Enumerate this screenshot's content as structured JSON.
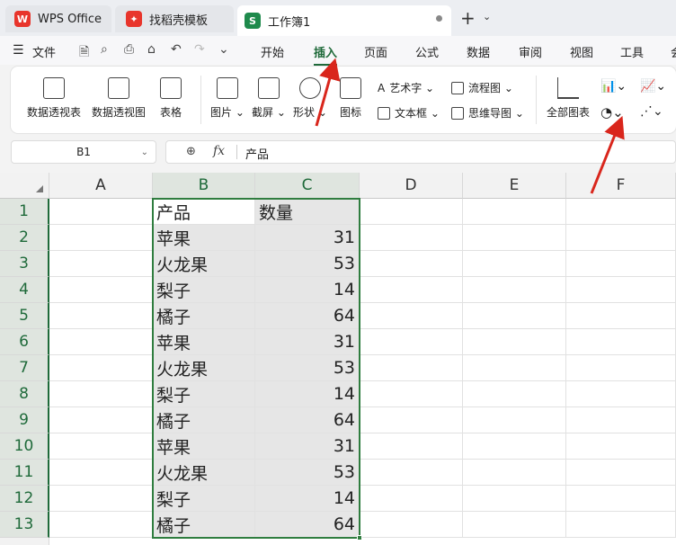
{
  "tabs": [
    {
      "label": "WPS Office",
      "icon": "wps-logo-icon",
      "color": "#e8352c"
    },
    {
      "label": "找稻壳模板",
      "icon": "docer-icon",
      "color": "#e8352c"
    },
    {
      "label": "工作簿1",
      "icon": "spreadsheet-s-icon",
      "color": "#1e8a4c"
    }
  ],
  "menu": {
    "file": "文件",
    "tabs": [
      "开始",
      "插入",
      "页面",
      "公式",
      "数据",
      "审阅",
      "视图",
      "工具",
      "会"
    ],
    "active": "插入"
  },
  "ribbon": {
    "pivot_table": "数据透视表",
    "pivot_chart": "数据透视图",
    "table": "表格",
    "picture": "图片",
    "screenshot": "截屏",
    "shape": "形状",
    "icon": "图标",
    "wordart": "艺术字",
    "textbox": "文本框",
    "flowchart": "流程图",
    "mindmap": "思维导图",
    "all_charts": "全部图表"
  },
  "formula_bar": {
    "cell_ref": "B1",
    "fx": "fx",
    "value": "产品"
  },
  "columns": [
    "A",
    "B",
    "C",
    "D",
    "E",
    "F"
  ],
  "rows": [
    "1",
    "2",
    "3",
    "4",
    "5",
    "6",
    "7",
    "8",
    "9",
    "10",
    "11",
    "12",
    "13"
  ],
  "table": {
    "header": [
      "产品",
      "数量"
    ],
    "data": [
      [
        "苹果",
        "31"
      ],
      [
        "火龙果",
        "53"
      ],
      [
        "梨子",
        "14"
      ],
      [
        "橘子",
        "64"
      ],
      [
        "苹果",
        "31"
      ],
      [
        "火龙果",
        "53"
      ],
      [
        "梨子",
        "14"
      ],
      [
        "橘子",
        "64"
      ],
      [
        "苹果",
        "31"
      ],
      [
        "火龙果",
        "53"
      ],
      [
        "梨子",
        "14"
      ],
      [
        "橘子",
        "64"
      ]
    ]
  },
  "colors": {
    "accent": "#1f6a3a",
    "selection": "#2f7d3f",
    "arrow": "#d9261c"
  }
}
